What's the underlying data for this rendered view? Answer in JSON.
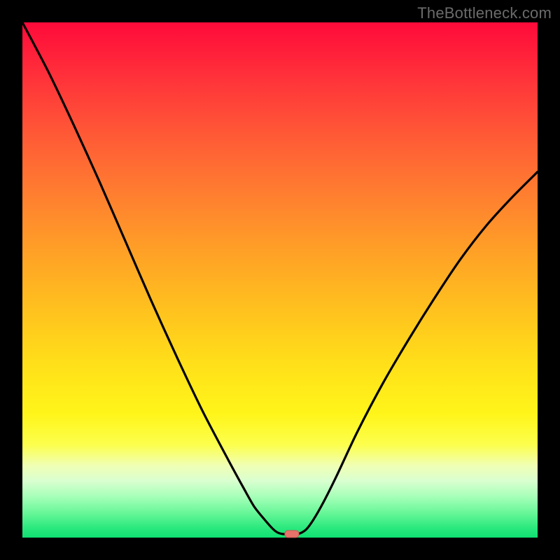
{
  "watermark": {
    "label": "TheBottleneck.com"
  },
  "chart_data": {
    "type": "line",
    "title": "",
    "xlabel": "",
    "ylabel": "",
    "xlim": [
      0,
      100
    ],
    "ylim": [
      0,
      100
    ],
    "grid": false,
    "legend": false,
    "curve_points": [
      {
        "x": 0,
        "y": 100
      },
      {
        "x": 5,
        "y": 90.5
      },
      {
        "x": 10,
        "y": 80.0
      },
      {
        "x": 15,
        "y": 69.0
      },
      {
        "x": 20,
        "y": 57.5
      },
      {
        "x": 25,
        "y": 46.0
      },
      {
        "x": 30,
        "y": 35.0
      },
      {
        "x": 35,
        "y": 24.5
      },
      {
        "x": 40,
        "y": 15.0
      },
      {
        "x": 43,
        "y": 9.5
      },
      {
        "x": 45,
        "y": 6.0
      },
      {
        "x": 47,
        "y": 3.5
      },
      {
        "x": 48.5,
        "y": 1.8
      },
      {
        "x": 49.5,
        "y": 1.0
      },
      {
        "x": 50.5,
        "y": 0.7
      },
      {
        "x": 52.0,
        "y": 0.7
      },
      {
        "x": 53.5,
        "y": 0.7
      },
      {
        "x": 55.0,
        "y": 1.5
      },
      {
        "x": 56.5,
        "y": 3.5
      },
      {
        "x": 58.5,
        "y": 7.0
      },
      {
        "x": 61,
        "y": 12.0
      },
      {
        "x": 65,
        "y": 20.5
      },
      {
        "x": 70,
        "y": 30.0
      },
      {
        "x": 75,
        "y": 38.5
      },
      {
        "x": 80,
        "y": 46.5
      },
      {
        "x": 85,
        "y": 54.0
      },
      {
        "x": 90,
        "y": 60.5
      },
      {
        "x": 95,
        "y": 66.0
      },
      {
        "x": 100,
        "y": 71.0
      }
    ],
    "marker": {
      "x": 52.3,
      "y": 0.7,
      "shape": "rounded-rect"
    },
    "gradient_stops": [
      {
        "pct": 0,
        "color": "#ff0a3a"
      },
      {
        "pct": 10,
        "color": "#ff2f3a"
      },
      {
        "pct": 22,
        "color": "#ff5a36"
      },
      {
        "pct": 33,
        "color": "#ff7d30"
      },
      {
        "pct": 45,
        "color": "#ffa226"
      },
      {
        "pct": 56,
        "color": "#ffc21e"
      },
      {
        "pct": 67,
        "color": "#ffe119"
      },
      {
        "pct": 76,
        "color": "#fff51a"
      },
      {
        "pct": 82,
        "color": "#fcff4d"
      },
      {
        "pct": 86,
        "color": "#f0ffb4"
      },
      {
        "pct": 89,
        "color": "#d9ffd0"
      },
      {
        "pct": 92,
        "color": "#a7ffb8"
      },
      {
        "pct": 95,
        "color": "#6cf79b"
      },
      {
        "pct": 98,
        "color": "#2de97e"
      },
      {
        "pct": 100,
        "color": "#0ee071"
      }
    ]
  }
}
